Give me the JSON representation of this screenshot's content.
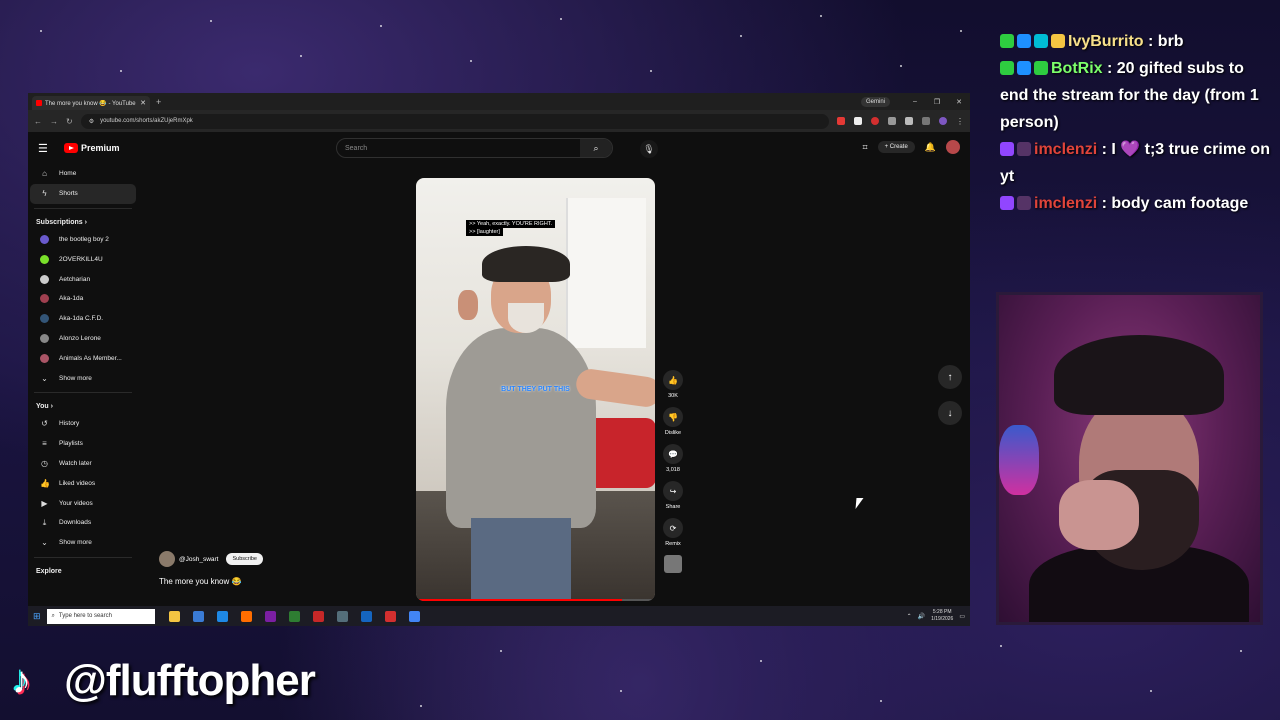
{
  "browser": {
    "tab_title": "The more you know 😂 - YouTube",
    "new_tab": "+",
    "gemini": "Gemini",
    "controls": [
      "–",
      "❐",
      "✕"
    ],
    "url": "youtube.com/shorts/akZUjeRmXpk"
  },
  "youtube": {
    "brand": "Premium",
    "search_placeholder": "Search",
    "create_label": "Create",
    "sidebar_top": [
      {
        "label": "Home",
        "icon": "home-icon",
        "glyph": "⌂"
      },
      {
        "label": "Shorts",
        "icon": "shorts-icon",
        "glyph": "ϟ"
      }
    ],
    "subscriptions_heading": "Subscriptions",
    "subscriptions": [
      {
        "label": "the bootleg boy 2",
        "color": "#6a5acd"
      },
      {
        "label": "2OVERKILL4U",
        "color": "#7ae02a"
      },
      {
        "label": "Aetcharian",
        "color": "#cccccc"
      },
      {
        "label": "Aka-1da",
        "color": "#a04050"
      },
      {
        "label": "Aka-1da C.F.D.",
        "color": "#335577"
      },
      {
        "label": "Alonzo Lerone",
        "color": "#888888"
      },
      {
        "label": "Animals As Member...",
        "color": "#aa5566"
      }
    ],
    "show_more": "Show more",
    "you_heading": "You",
    "you_items": [
      {
        "label": "History",
        "glyph": "↺"
      },
      {
        "label": "Playlists",
        "glyph": "≡"
      },
      {
        "label": "Watch later",
        "glyph": "◷"
      },
      {
        "label": "Liked videos",
        "glyph": "👍"
      },
      {
        "label": "Your videos",
        "glyph": "▶"
      },
      {
        "label": "Downloads",
        "glyph": "⤓"
      }
    ],
    "show_more_2": "Show more",
    "explore_heading": "Explore",
    "short": {
      "cc_line1": ">> Yeah, exactly. YOU'RE RIGHT.",
      "cc_line2": ">> [laughter]",
      "caption": "BUT THEY PUT THIS",
      "progress": 0.86,
      "channel": "@Josh_swart",
      "subscribe": "Subscribe",
      "title": "The more you know 😂"
    },
    "actions": [
      {
        "label": "30K",
        "icon": "like-icon",
        "glyph": "👍"
      },
      {
        "label": "Dislike",
        "icon": "dislike-icon",
        "glyph": "👎"
      },
      {
        "label": "3,018",
        "icon": "comment-icon",
        "glyph": "💬"
      },
      {
        "label": "Share",
        "icon": "share-icon",
        "glyph": "↪"
      },
      {
        "label": "Remix",
        "icon": "remix-icon",
        "glyph": "⟳"
      }
    ]
  },
  "taskbar": {
    "search_placeholder": "Type here to search",
    "time": "5:28 PM",
    "date": "1/19/2026",
    "icon_colors": [
      "#f4c542",
      "#3a7bd5",
      "#1e88e5",
      "#ff6d00",
      "#7b1fa2",
      "#2e7d32",
      "#c62828",
      "#546e7a",
      "#1565c0",
      "#d32f2f",
      "#4285f4"
    ]
  },
  "chat": [
    {
      "user": "IvyBurrito",
      "user_color": "#f7e08a",
      "text": " : brb",
      "badges": [
        "#2ecc40",
        "#1e90ff",
        "#00bcd4",
        "#f4c542"
      ]
    },
    {
      "user": "BotRix",
      "user_color": "#7cff6b",
      "text": " : 20 gifted subs to end the stream for the day (from 1 person)",
      "badges": [
        "#2ecc40",
        "#1e90ff",
        "#2ecc40"
      ]
    },
    {
      "user": "imclenzi",
      "user_color": "#e0443a",
      "text": " : I 💜 t;3 true crime on yt",
      "badges": [
        "#9146ff",
        "#553366"
      ]
    },
    {
      "user": "imclenzi",
      "user_color": "#e0443a",
      "text": " : body cam footage",
      "badges": [
        "#9146ff",
        "#553366"
      ]
    }
  ],
  "overlay": {
    "tiktok_handle": "@flufftopher"
  }
}
